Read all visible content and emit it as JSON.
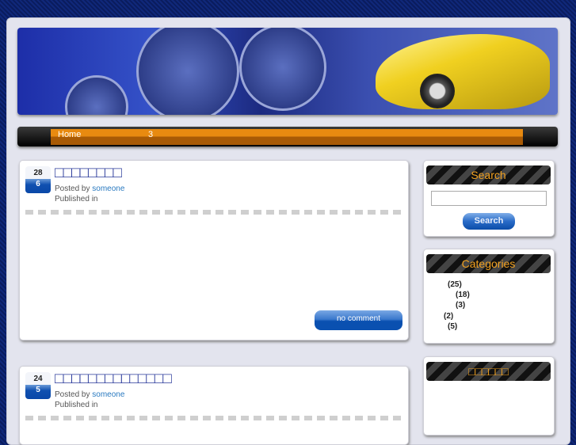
{
  "nav": {
    "items": [
      "Home",
      "3"
    ]
  },
  "posts": [
    {
      "day": "28",
      "month": "6",
      "title": "□□□□□□□□",
      "posted_by_label": "Posted by",
      "author": "someone",
      "published_label": "Published in",
      "comment_button": "no comment"
    },
    {
      "day": "24",
      "month": "5",
      "title": "□□□□□□□□□□□□□□",
      "posted_by_label": "Posted by",
      "author": "someone",
      "published_label": "Published in"
    }
  ],
  "sidebar": {
    "search": {
      "title": "Search",
      "input_value": "",
      "button": "Search"
    },
    "categories": {
      "title": "Categories",
      "counts": [
        "(25)",
        "(18)",
        "(3)",
        "(2)",
        "(5)"
      ]
    },
    "third": {
      "title": "□□□□□□"
    }
  }
}
